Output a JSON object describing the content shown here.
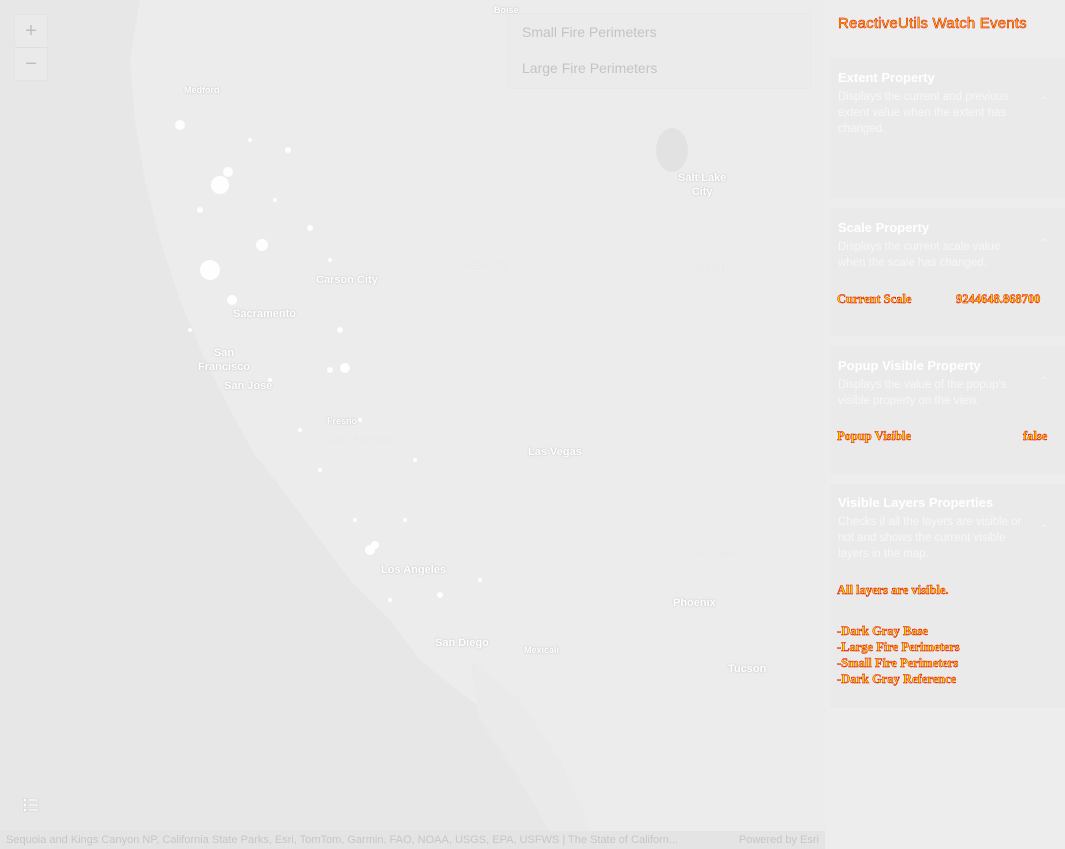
{
  "map": {
    "zoom_in_label": "+",
    "zoom_out_label": "−",
    "cities": {
      "boise": "Boise",
      "medford": "Medford",
      "salt_lake_city": "Salt Lake\nCity",
      "carson_city": "Carson City",
      "sacramento": "Sacramento",
      "san_francisco": "San\nFrancisco",
      "san_jose": "San Jose",
      "fresno": "Fresno",
      "las_vegas": "Las Vegas",
      "los_angeles": "Los Angeles",
      "san_diego": "San Diego",
      "mexicali": "Mexicali",
      "phoenix": "Phoenix",
      "tucson": "Tucson"
    },
    "regions": {
      "nevada": "NEVADA",
      "utah": "UTAH",
      "california": "CALIFORNIA",
      "arizona": "ARIZONA"
    },
    "attribution": "Sequoia and Kings Canyon NP, California State Parks, Esri, TomTom, Garmin, FAO, NOAA, USGS, EPA, USFWS | The State of Californ...",
    "powered_by": "Powered by Esri"
  },
  "layer_panel": {
    "items": [
      "Small Fire Perimeters",
      "Large Fire Perimeters"
    ]
  },
  "panel": {
    "title": "ReactiveUtils Watch Events",
    "extent": {
      "title": "Extent Property",
      "description": "Displays the current and previous extent value when the extent has changed."
    },
    "scale": {
      "title": "Scale Property",
      "description": "Displays the current scale value when the scale has changed.",
      "label": "Current Scale",
      "value": "9244648.868700"
    },
    "popup": {
      "title": "Popup Visible Property",
      "description": "Displays the value of the popup's visible property on the view.",
      "label": "Popup Visible",
      "value": "false"
    },
    "layers": {
      "title": "Visible Layers Properties",
      "description": "Checks if all the layers are visible or not and shows the current visible layers in the map.",
      "status": "All layers are visible.",
      "list": [
        "-Dark Gray Base",
        "-Large Fire Perimeters",
        "-Small Fire Perimeters",
        "-Dark Gray Reference"
      ]
    }
  },
  "colors": {
    "map_background": "#e9e9e9",
    "label_fill": "#ffd700",
    "label_stroke": "#e00000"
  },
  "icons": [
    "zoom-in-icon",
    "zoom-out-icon",
    "layer-list-icon",
    "chevron-up-icon"
  ]
}
